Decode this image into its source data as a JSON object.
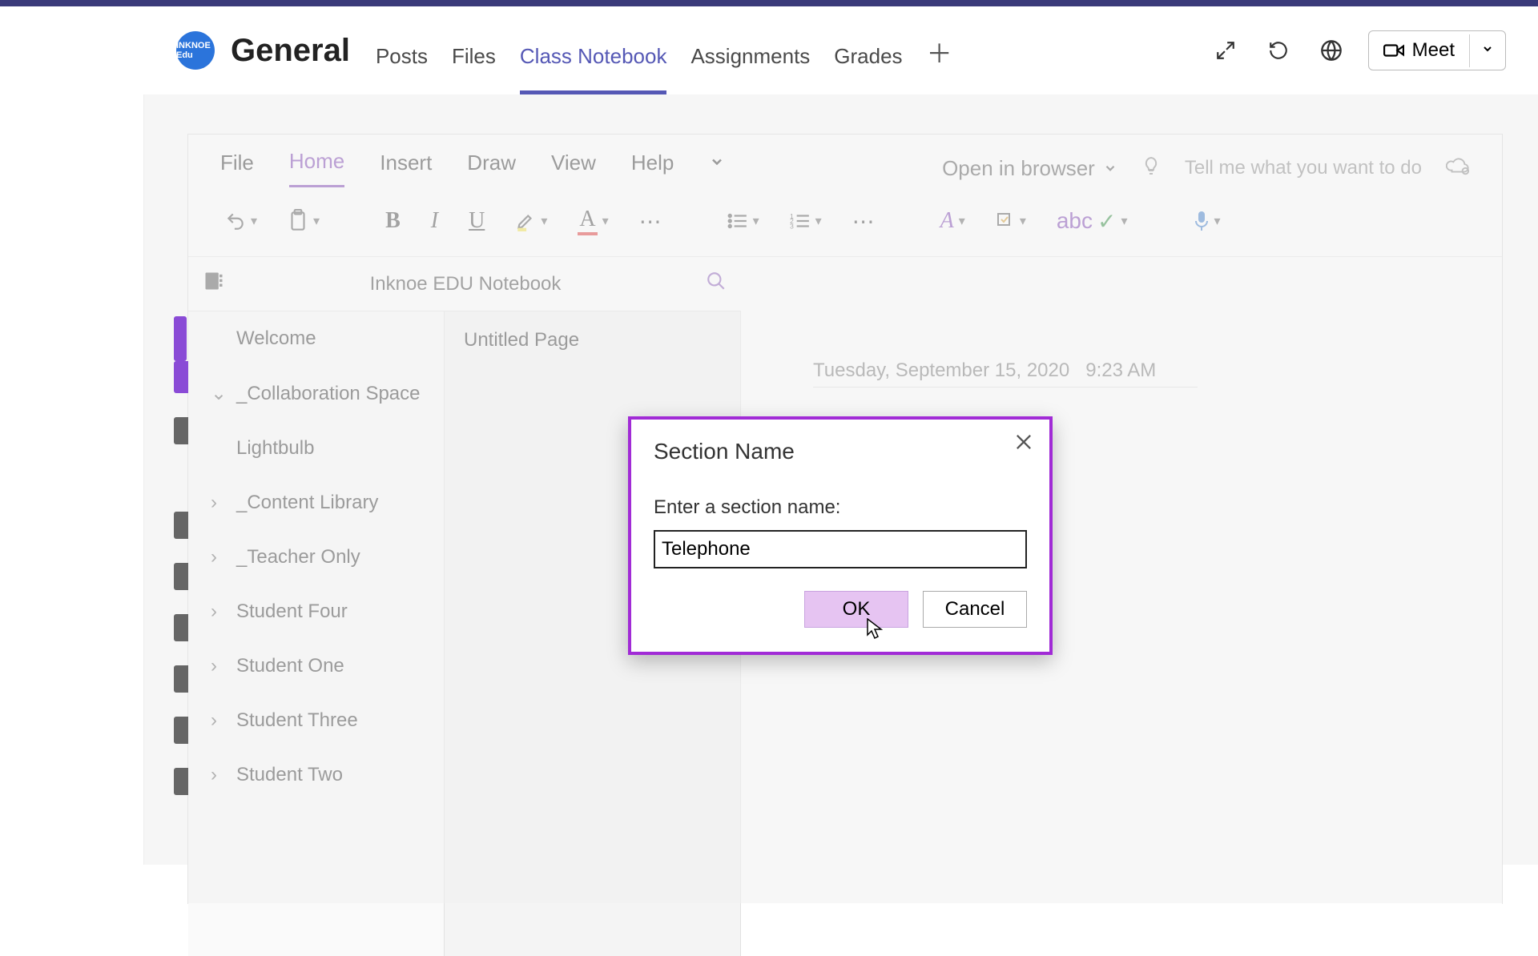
{
  "team": {
    "avatar_text": "INKNOE Edu",
    "channel": "General"
  },
  "tabs": [
    {
      "label": "Posts"
    },
    {
      "label": "Files"
    },
    {
      "label": "Class Notebook"
    },
    {
      "label": "Assignments"
    },
    {
      "label": "Grades"
    }
  ],
  "active_tab_index": 2,
  "meet_label": "Meet",
  "ribbon": {
    "tabs": [
      "File",
      "Home",
      "Insert",
      "Draw",
      "View",
      "Help"
    ],
    "active_index": 1,
    "open_in_browser": "Open in browser",
    "tell_me": "Tell me what you want to do"
  },
  "notebook": {
    "title": "Inknoe EDU Notebook",
    "sections": [
      {
        "label": "Welcome",
        "expanded": false,
        "selected": true
      },
      {
        "label": "_Collaboration Space",
        "expanded": true
      },
      {
        "label": "Lightbulb",
        "child": true
      },
      {
        "label": "_Content Library",
        "expanded": false
      },
      {
        "label": "_Teacher Only",
        "expanded": false
      },
      {
        "label": "Student Four",
        "expanded": false
      },
      {
        "label": "Student One",
        "expanded": false
      },
      {
        "label": "Student Three",
        "expanded": false
      },
      {
        "label": "Student Two",
        "expanded": false
      }
    ],
    "pages": [
      {
        "label": "Untitled Page"
      }
    ],
    "canvas": {
      "date": "Tuesday, September 15, 2020",
      "time": "9:23 AM"
    }
  },
  "modal": {
    "title": "Section Name",
    "label": "Enter a section name:",
    "value": "Telephone",
    "ok": "OK",
    "cancel": "Cancel"
  }
}
